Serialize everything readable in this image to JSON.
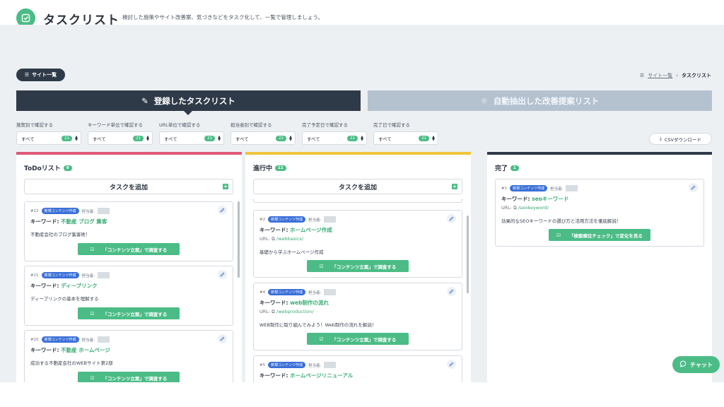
{
  "header": {
    "title": "タスクリスト",
    "description": "検討した施策やサイト改善案、気づきなどをタスク化して、一覧で管理しましょう。",
    "icon": "check-square-icon"
  },
  "site_list_button": "サイト一覧",
  "breadcrumb": {
    "parent": "サイト一覧",
    "separator": "›",
    "current": "タスクリスト"
  },
  "tabs": {
    "active": "登録したタスクリスト",
    "inactive": "自動抽出した改善提案リスト"
  },
  "filters": [
    {
      "label": "施策別で確認する",
      "value": "すべて",
      "count": "21"
    },
    {
      "label": "キーワード単位で確認する",
      "value": "すべて",
      "count": "21"
    },
    {
      "label": "URL単位で確認する",
      "value": "すべて",
      "count": "21"
    },
    {
      "label": "担当者別で確認する",
      "value": "すべて",
      "count": "21"
    },
    {
      "label": "完了予定日で確認する",
      "value": "すべて",
      "count": "21"
    },
    {
      "label": "完了日で確認する",
      "value": "すべて",
      "count": "21"
    }
  ],
  "csv_button": "CSVダウンロード",
  "add_task_label": "タスクを追加",
  "keyword_prefix": "キーワード: ",
  "url_prefix": "URL: ",
  "assignee_label": "担当者:",
  "columns": {
    "todo": {
      "title": "ToDoリスト",
      "count": "9",
      "color": "#df5a78",
      "cards": [
        {
          "id": "#22",
          "tag": "新規コンテンツ作成",
          "keyword": "不動産 ブログ 集客",
          "description": "不動産会社のブログ集客術！",
          "button": "「コンテンツ立案」で調査する"
        },
        {
          "id": "#21",
          "tag": "新規コンテンツ作成",
          "keyword": "ディープリンク",
          "description": "ディープリンクの基本を理解する",
          "button": "「コンテンツ立案」で調査する"
        },
        {
          "id": "#20",
          "tag": "新規コンテンツ作成",
          "keyword": "不動産 ホームページ",
          "description": "成功する不動産会社のWEBサイト第2部",
          "button": "「コンテンツ立案」で調査する"
        }
      ]
    },
    "doing": {
      "title": "進行中",
      "count": "11",
      "color": "#f0c43c",
      "cards": [
        {
          "id": "#2",
          "tag": "新規コンテンツ作成",
          "keyword": "ホームページ作成",
          "url": "/webbasics/",
          "description": "基礎から学ぶホームページ作成",
          "button": "「コンテンツ立案」で調査する"
        },
        {
          "id": "#4",
          "tag": "新規コンテンツ作成",
          "keyword": "web制作の流れ",
          "url": "/webproduction/",
          "description": "WEB制作に取り組んでみよう！Web制作の流れを解説！",
          "button": "「コンテンツ立案」で調査する"
        },
        {
          "id": "#5",
          "tag": "新規コンテンツ作成",
          "keyword": "ホームページリニューアル"
        }
      ]
    },
    "done": {
      "title": "完了",
      "count": "1",
      "color": "#2f3a48",
      "cards": [
        {
          "id": "#1",
          "tag": "新規コンテンツ作成",
          "keyword": "seoキーワード",
          "url": "/seokeyword/",
          "description": "効果的なSEOキーワードの選び方と活用方法を徹底解説！",
          "button": "「検索順位チェック」で変化を見る"
        }
      ]
    }
  },
  "chat_button": "チャット",
  "colors": {
    "accent": "#4cbc86",
    "dark": "#2f3a48",
    "tag_blue": "#3a6fd8"
  }
}
